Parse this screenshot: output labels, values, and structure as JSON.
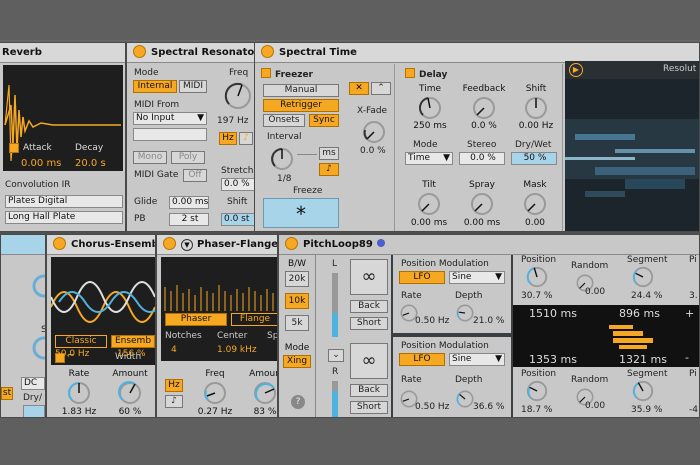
{
  "reverb": {
    "title": "Reverb",
    "attack_label": "Attack",
    "attack_value": "0.00 ms",
    "decay_label": "Decay",
    "decay_value": "20.0 s",
    "ir_label": "Convolution IR",
    "ir_category": "Plates Digital",
    "ir_file": "Long Hall Plate"
  },
  "spectral_resonator": {
    "title": "Spectral Resonator",
    "mode_label": "Mode",
    "mode_internal": "Internal",
    "mode_midi": "MIDI",
    "freq_label": "Freq",
    "freq_value": "197 Hz",
    "hz_button": "Hz",
    "midi_from_label": "MIDI From",
    "midi_from_value": "No Input",
    "mono_label": "Mono",
    "poly_label": "Poly",
    "midi_gate_label": "MIDI Gate",
    "midi_gate_value": "Off",
    "stretch_label": "Stretch",
    "stretch_value": "0.0 %",
    "glide_label": "Glide",
    "glide_value": "0.00 ms",
    "pb_label": "PB",
    "pb_value": "2 st",
    "shift_label": "Shift",
    "shift_value": "0.0 st"
  },
  "spectral_time": {
    "title": "Spectral Time",
    "freezer_label": "Freezer",
    "manual_label": "Manual",
    "retrigger_label": "Retrigger",
    "onsets_label": "Onsets",
    "sync_label": "Sync",
    "interval_label": "Interval",
    "interval_value": "1/8",
    "ms_label": "ms",
    "note_icon": "♪",
    "xfade_label": "X-Fade",
    "xfade_value": "0.0 %",
    "freeze_label": "Freeze",
    "freeze_symbol": "*",
    "delay_label": "Delay",
    "time_label": "Time",
    "time_value": "250 ms",
    "feedback_label": "Feedback",
    "feedback_value": "0.0 %",
    "shift_label": "Shift",
    "shift_value": "0.00 Hz",
    "mode_label": "Mode",
    "mode_value": "Time",
    "stereo_label": "Stereo",
    "stereo_value": "0.0 %",
    "drywet_label": "Dry/Wet",
    "drywet_value": "50 %",
    "tilt_label": "Tilt",
    "tilt_value": "0.00 ms",
    "spray_label": "Spray",
    "spray_value": "0.00 ms",
    "mask_label": "Mask",
    "mask_value": "0.00",
    "resolution_label": "Resolut"
  },
  "chorus": {
    "title": "Chorus-Ensemble",
    "classic_label": "Classic",
    "ensemble_label": "Ensemb",
    "rate_small_value": "50.0 Hz",
    "width_label": "Width",
    "width_value": "156 %",
    "rate_label": "Rate",
    "rate_value": "1.83 Hz",
    "amount_label": "Amount",
    "amount_value": "60 %"
  },
  "phaser": {
    "title": "Phaser-Flanger",
    "phaser_label": "Phaser",
    "flanger_label": "Flange",
    "notches_label": "Notches",
    "notches_value": "4",
    "center_label": "Center",
    "center_value": "1.09 kHz",
    "spread_label": "Sp",
    "hz_label": "Hz",
    "note_icon": "♪",
    "freq_label": "Freq",
    "freq_value": "0.27 Hz",
    "amount_label": "Amoun",
    "amount_value": "83 %"
  },
  "left_partial": {
    "st_label": "S",
    "dc_label": "DC",
    "drywet_label": "Dry/",
    "st_btn": "st"
  },
  "pitchloop": {
    "title": "PitchLoop89",
    "bw_label": "B/W",
    "bw_20k": "20k",
    "bw_10k": "10k",
    "bw_5k": "5k",
    "mode_label": "Mode",
    "mode_value": "Xing",
    "help_icon": "?",
    "l_label": "L",
    "r_label": "R",
    "back_label": "Back",
    "short_label": "Short",
    "infinity": "∞",
    "posmod_label": "Position Modulation",
    "lfo_label": "LFO",
    "sine_label": "Sine",
    "rate_label": "Rate",
    "depth_label": "Depth",
    "rate1_value": "0.50 Hz",
    "depth1_value": "21.0 %",
    "rate2_value": "0.50 Hz",
    "depth2_value": "36.6 %",
    "position_label": "Position",
    "random_label": "Random",
    "segment_label": "Segment",
    "pi_label": "Pi",
    "pos1_value": "30.7 %",
    "rand1_value": "0.00",
    "seg1_value": "24.4 %",
    "pi1_value": "3.",
    "pos2_value": "18.7 %",
    "rand2_value": "0.00",
    "seg2_value": "35.9 %",
    "pi2_value": "-4",
    "display_tl": "1510 ms",
    "display_tr": "896 ms",
    "display_bl": "1353 ms",
    "display_br": "1321 ms",
    "plus": "+",
    "minus": "-"
  },
  "colors": {
    "accent": "#f6a823",
    "value_blue": "#1a4fa3",
    "selected_field": "#a8d4ea",
    "panel": "#c8c8c8",
    "background": "#666666"
  }
}
